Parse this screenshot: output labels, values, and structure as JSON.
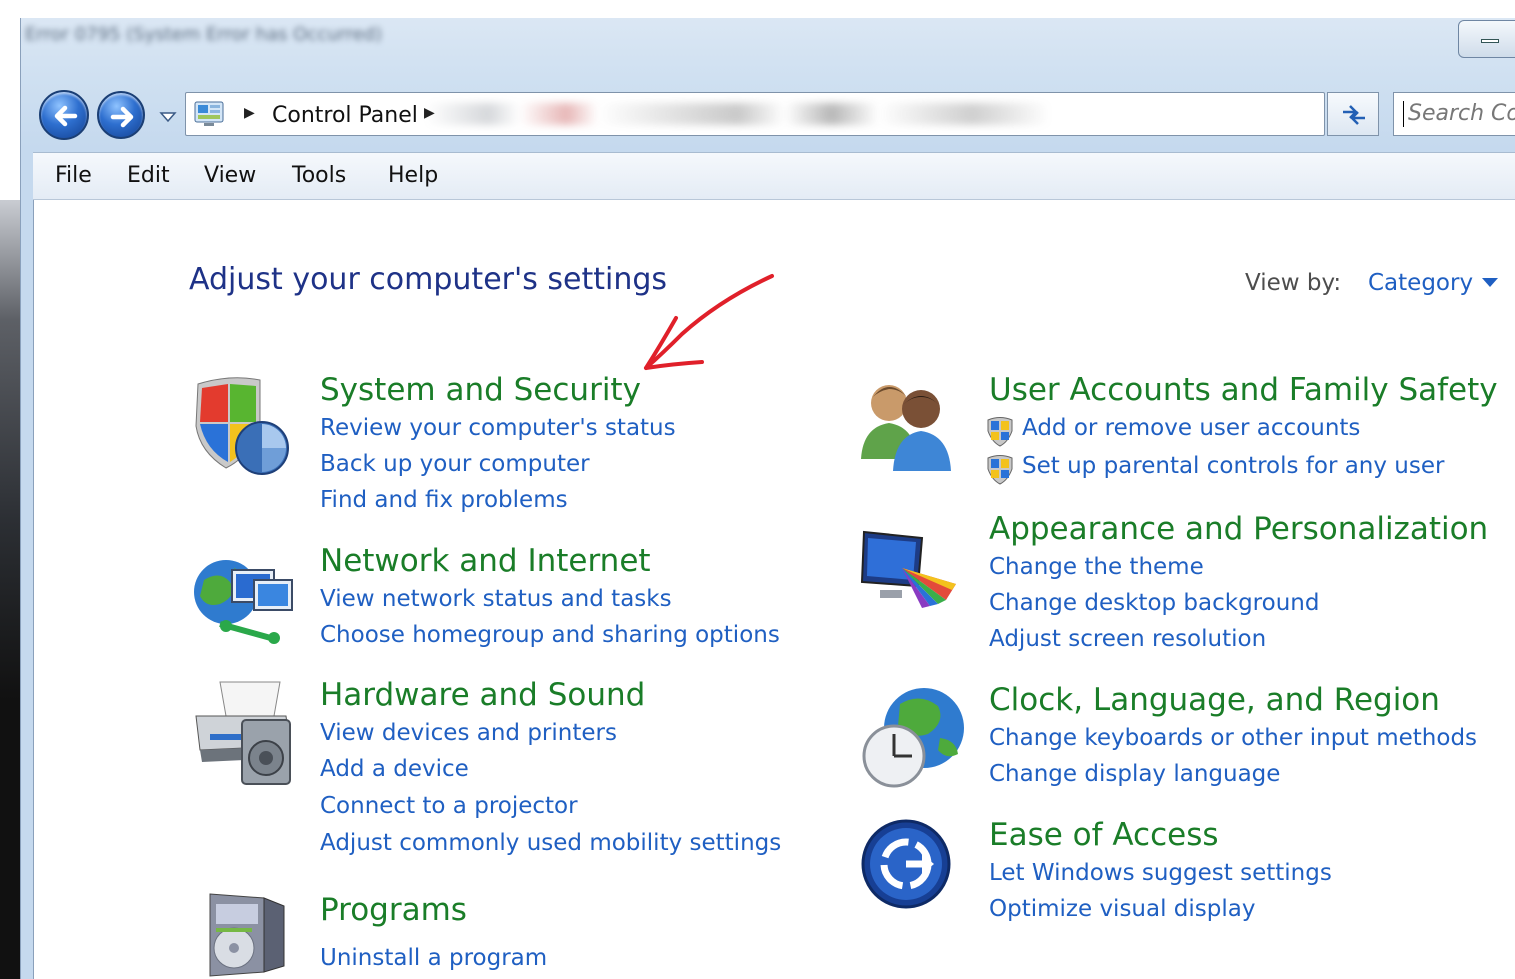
{
  "window": {
    "title": "Error 0795 (System Error has Occurred)"
  },
  "address_bar": {
    "breadcrumb": "Control Panel",
    "search_placeholder": "Search Co"
  },
  "menu": {
    "items": [
      "File",
      "Edit",
      "View",
      "Tools",
      "Help"
    ]
  },
  "page": {
    "heading": "Adjust your computer's settings",
    "view_by_label": "View by:",
    "view_by_value": "Category"
  },
  "categories": {
    "system_security": {
      "title": "System and Security",
      "links": [
        "Review your computer's status",
        "Back up your computer",
        "Find and fix problems"
      ]
    },
    "network_internet": {
      "title": "Network and Internet",
      "links": [
        "View network status and tasks",
        "Choose homegroup and sharing options"
      ]
    },
    "hardware_sound": {
      "title": "Hardware and Sound",
      "links": [
        "View devices and printers",
        "Add a device",
        "Connect to a projector",
        "Adjust commonly used mobility settings"
      ]
    },
    "programs": {
      "title": "Programs",
      "links": [
        "Uninstall a program"
      ]
    },
    "user_accounts": {
      "title": "User Accounts and Family Safety",
      "links": [
        "Add or remove user accounts",
        "Set up parental controls for any user"
      ]
    },
    "appearance": {
      "title": "Appearance and Personalization",
      "links": [
        "Change the theme",
        "Change desktop background",
        "Adjust screen resolution"
      ]
    },
    "clock_region": {
      "title": "Clock, Language, and Region",
      "links": [
        "Change keyboards or other input methods",
        "Change display language"
      ]
    },
    "ease_access": {
      "title": "Ease of Access",
      "links": [
        "Let Windows suggest settings",
        "Optimize visual display"
      ]
    }
  },
  "colors": {
    "category_title": "#1a7d28",
    "link": "#1f5fc2",
    "heading": "#1e3287",
    "annotation_arrow": "#e0202a"
  }
}
